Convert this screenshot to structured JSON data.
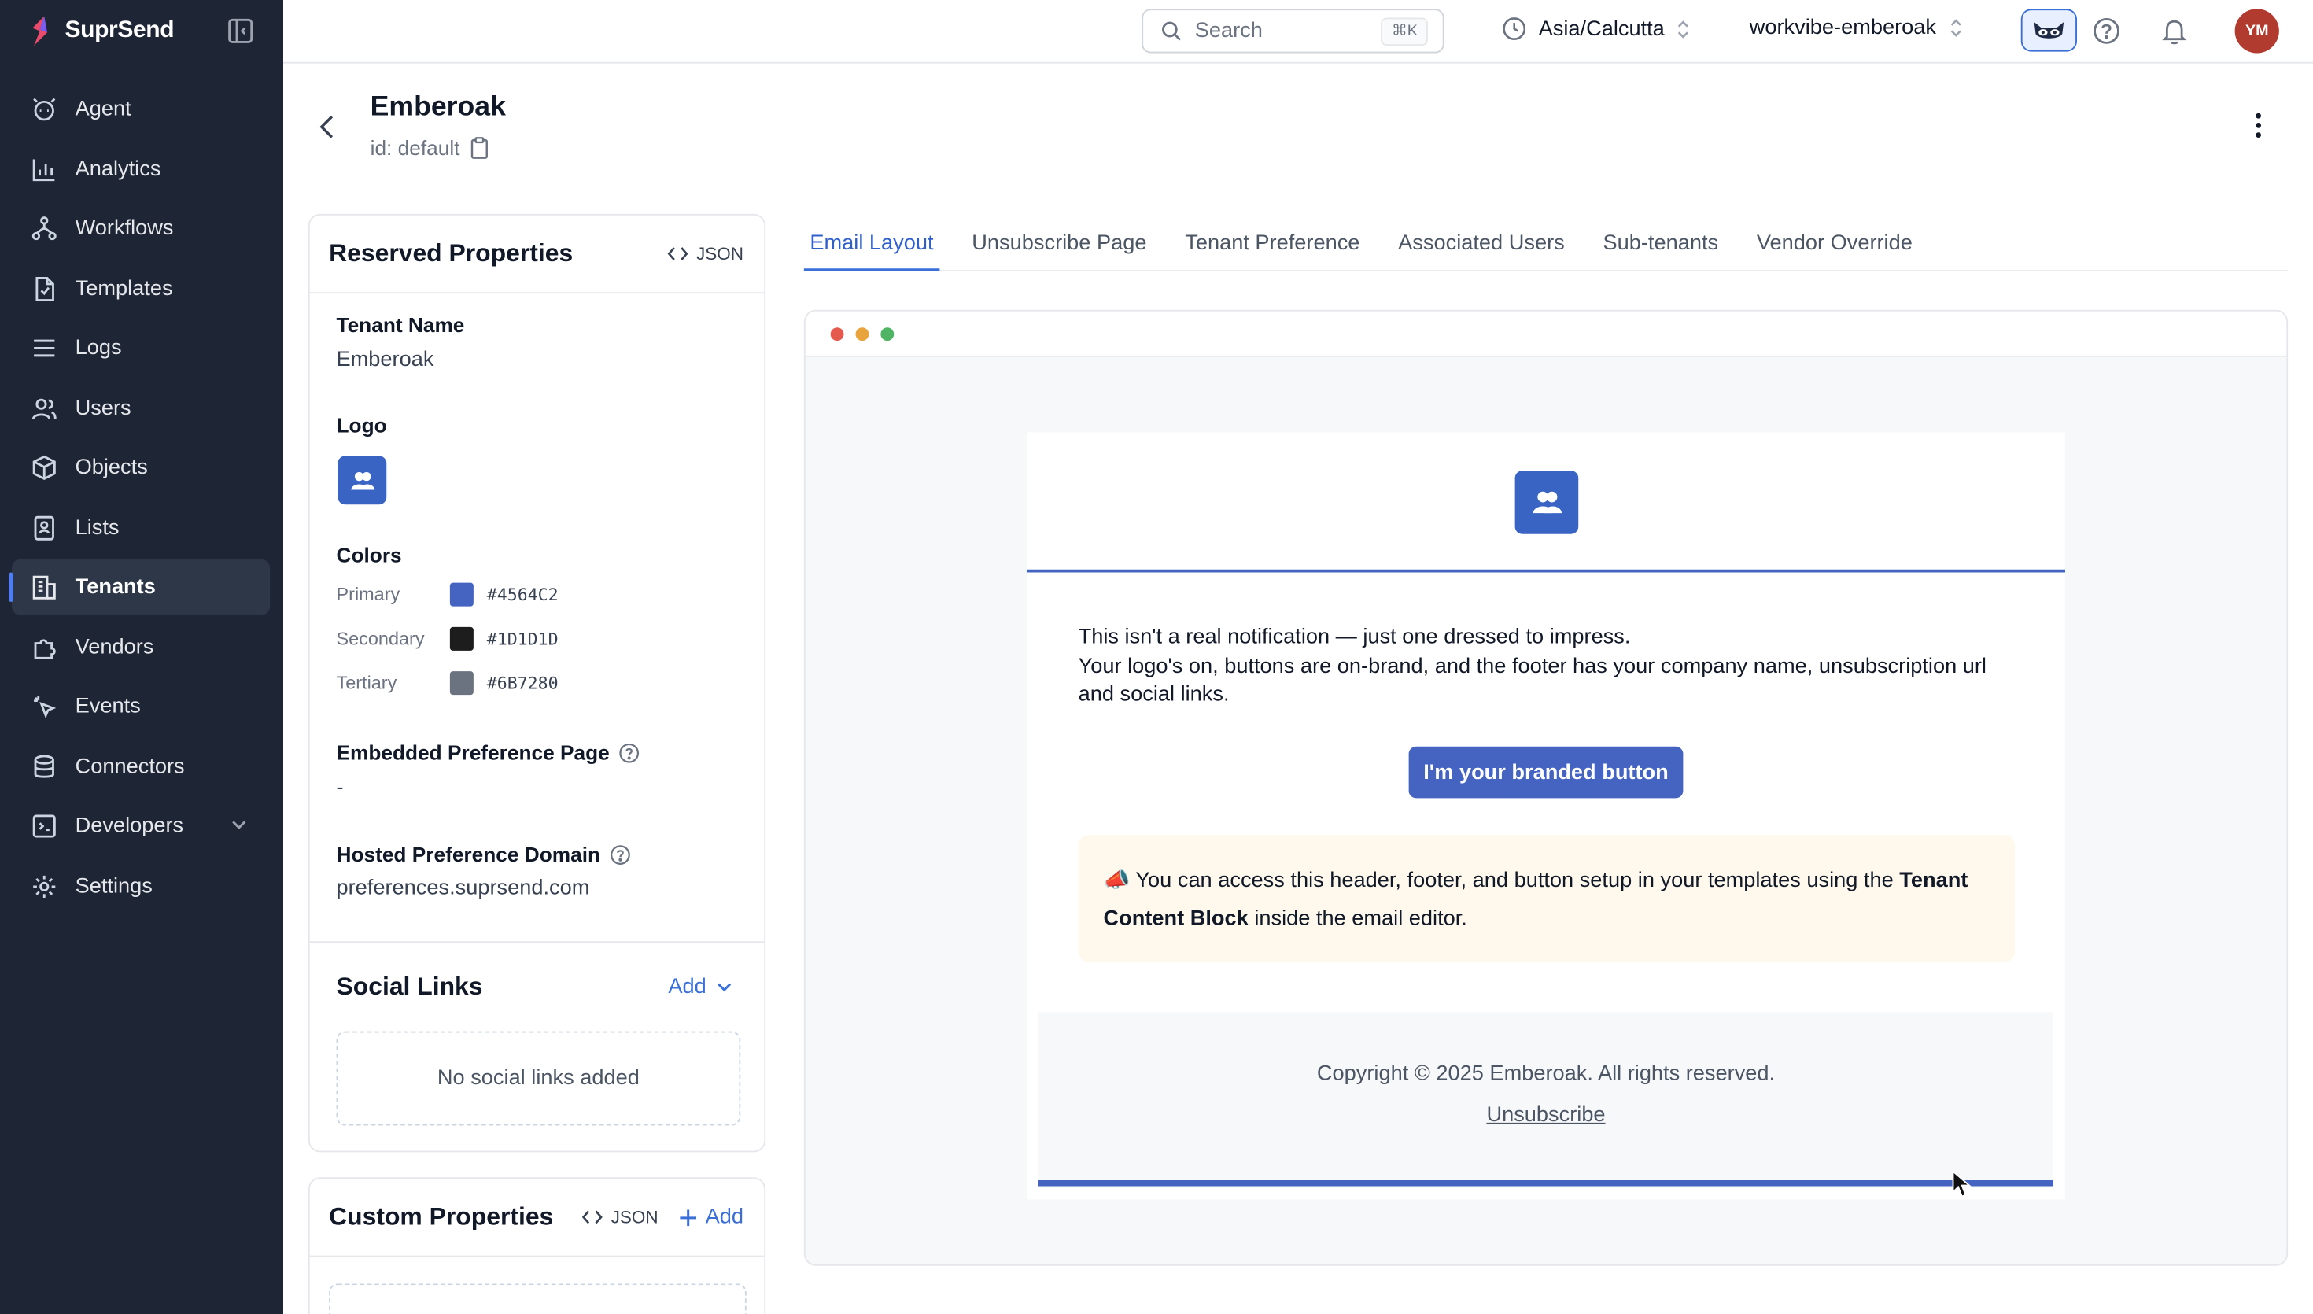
{
  "brand": {
    "name": "SuprSend"
  },
  "sidebar": {
    "items": [
      {
        "label": "Agent",
        "icon": "agent-icon"
      },
      {
        "label": "Analytics",
        "icon": "chart-bar-icon"
      },
      {
        "label": "Workflows",
        "icon": "workflow-icon"
      },
      {
        "label": "Templates",
        "icon": "file-icon"
      },
      {
        "label": "Logs",
        "icon": "list-icon"
      },
      {
        "label": "Users",
        "icon": "users-icon"
      },
      {
        "label": "Objects",
        "icon": "cube-icon"
      },
      {
        "label": "Lists",
        "icon": "contact-list-icon"
      },
      {
        "label": "Tenants",
        "icon": "building-icon",
        "active": true
      },
      {
        "label": "Vendors",
        "icon": "puzzle-icon"
      },
      {
        "label": "Events",
        "icon": "pointer-icon"
      },
      {
        "label": "Connectors",
        "icon": "database-icon"
      },
      {
        "label": "Developers",
        "icon": "code-icon"
      },
      {
        "label": "Settings",
        "icon": "gear-icon"
      }
    ]
  },
  "topbar": {
    "search_placeholder": "Search",
    "search_shortcut": "⌘K",
    "timezone": "Asia/Calcutta",
    "workspace": "workvibe-emberoak",
    "avatar_initials": "YM"
  },
  "tenant": {
    "name": "Emberoak",
    "id_text": "id: default"
  },
  "reserved": {
    "title": "Reserved Properties",
    "json_label": "JSON",
    "tenant_name_label": "Tenant Name",
    "tenant_name_value": "Emberoak",
    "logo_label": "Logo",
    "colors_label": "Colors",
    "colors": [
      {
        "name": "Primary",
        "hex": "#4564C2"
      },
      {
        "name": "Secondary",
        "hex": "#1D1D1D"
      },
      {
        "name": "Tertiary",
        "hex": "#6B7280"
      }
    ],
    "embedded_label": "Embedded Preference Page",
    "embedded_value": "-",
    "hosted_label": "Hosted Preference Domain",
    "hosted_value": "preferences.suprsend.com"
  },
  "social": {
    "title": "Social Links",
    "add_label": "Add",
    "empty_text": "No social links added"
  },
  "custom": {
    "title": "Custom Properties",
    "json_label": "JSON",
    "add_label": "Add"
  },
  "tabs": [
    {
      "label": "Email Layout",
      "active": true
    },
    {
      "label": "Unsubscribe Page"
    },
    {
      "label": "Tenant Preference"
    },
    {
      "label": "Associated Users"
    },
    {
      "label": "Sub-tenants"
    },
    {
      "label": "Vendor Override"
    }
  ],
  "email": {
    "line1": "This isn't a real notification — just one dressed to impress.",
    "line2": "Your logo's on, buttons are on-brand, and the footer has your company name, unsubscription url and social links.",
    "button_label": "I'm your branded button",
    "note_prefix": "📣 You can access this header, footer, and button setup in your templates using the ",
    "note_bold": "Tenant Content Block",
    "note_suffix": " inside the email editor.",
    "copyright": "Copyright © 2025 Emberoak. All rights reserved.",
    "unsubscribe": "Unsubscribe"
  },
  "colors": {
    "sidebar_bg": "#1e2636",
    "accent": "#3b6fd8",
    "brand_primary": "#4564C2",
    "avatar_bg": "#b23b2f"
  }
}
